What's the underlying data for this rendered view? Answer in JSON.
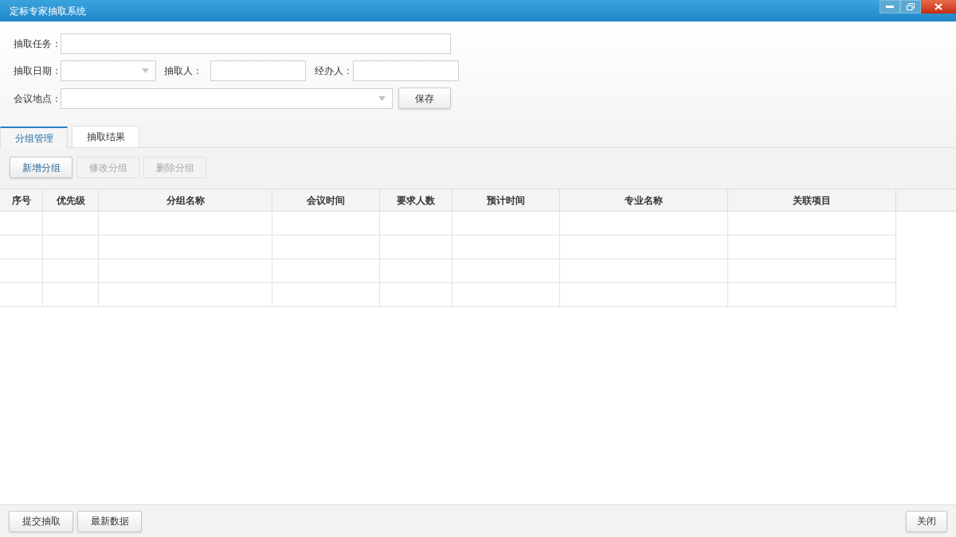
{
  "window": {
    "title": "定标专家抽取系统"
  },
  "form": {
    "task_label": "抽取任务：",
    "date_label": "抽取日期：",
    "drawer_label": "抽取人：",
    "handler_label": "经办人：",
    "location_label": "会议地点：",
    "save_button": "保存"
  },
  "tabs": [
    {
      "label": "分组管理",
      "selected": true
    },
    {
      "label": "抽取结果",
      "selected": false
    }
  ],
  "toolbar": [
    {
      "label": "新增分组",
      "disabled": false
    },
    {
      "label": "修改分组",
      "disabled": true
    },
    {
      "label": "删除分组",
      "disabled": true
    }
  ],
  "table": {
    "columns": [
      "序号",
      "优先级",
      "分组名称",
      "会议时间",
      "要求人数",
      "预计时间",
      "专业名称",
      "关联项目"
    ]
  },
  "footer": {
    "left_buttons": [
      "提交抽取",
      "最新数据"
    ],
    "right_buttons": [
      "关闭"
    ]
  }
}
